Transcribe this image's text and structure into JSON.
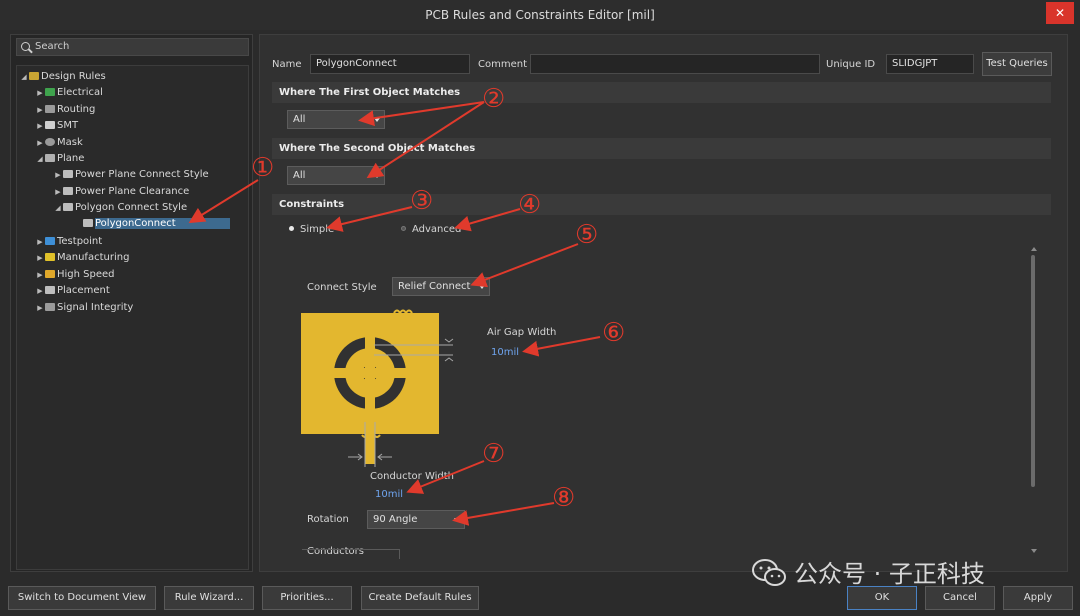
{
  "window": {
    "title": "PCB Rules and Constraints Editor [mil]",
    "close_glyph": "✕"
  },
  "search": {
    "placeholder": "Search"
  },
  "tree": {
    "root": "Design Rules",
    "items": [
      {
        "label": "Electrical",
        "icon": "electrical-icon",
        "color": "#3fa34d"
      },
      {
        "label": "Routing",
        "icon": "routing-icon",
        "color": "#9a9a9a"
      },
      {
        "label": "SMT",
        "icon": "smt-icon",
        "color": "#cfcfcf"
      },
      {
        "label": "Mask",
        "icon": "mask-icon",
        "color": "#9a9a9a"
      },
      {
        "label": "Plane",
        "icon": "plane-icon",
        "color": "#b0b0b0"
      },
      {
        "label": "Power Plane Connect Style",
        "icon": "rule-icon",
        "color": "#bdbdbd"
      },
      {
        "label": "Power Plane Clearance",
        "icon": "rule-icon",
        "color": "#bdbdbd"
      },
      {
        "label": "Polygon Connect Style",
        "icon": "rule-icon",
        "color": "#bdbdbd"
      },
      {
        "label": "PolygonConnect",
        "icon": "rule-icon",
        "color": "#bdbdbd"
      },
      {
        "label": "Testpoint",
        "icon": "testpoint-icon",
        "color": "#3e8fd6"
      },
      {
        "label": "Manufacturing",
        "icon": "manufacturing-icon",
        "color": "#e0c12a"
      },
      {
        "label": "High Speed",
        "icon": "high-speed-icon",
        "color": "#e0a82a"
      },
      {
        "label": "Placement",
        "icon": "placement-icon",
        "color": "#bdbdbd"
      },
      {
        "label": "Signal Integrity",
        "icon": "signal-integrity-icon",
        "color": "#9a9a9a"
      }
    ]
  },
  "rule": {
    "name_label": "Name",
    "name_value": "PolygonConnect",
    "comment_label": "Comment",
    "comment_value": "",
    "uid_label": "Unique ID",
    "uid_value": "SLIDGJPT",
    "test_queries": "Test Queries"
  },
  "sections": {
    "first": "Where The First Object Matches",
    "second": "Where The Second Object Matches",
    "constraints": "Constraints"
  },
  "first_match": "All",
  "second_match": "All",
  "mode": {
    "simple": "Simple",
    "advanced": "Advanced",
    "selected": "simple"
  },
  "connect_style": {
    "label": "Connect Style",
    "value": "Relief Connect"
  },
  "air_gap": {
    "label": "Air Gap Width",
    "value": "10mil"
  },
  "conductor_width": {
    "label": "Conductor Width",
    "value": "10mil"
  },
  "rotation": {
    "label": "Rotation",
    "value": "90 Angle"
  },
  "conductors": {
    "label": "Conductors"
  },
  "footer": {
    "switch": "Switch to Document View",
    "wizard": "Rule Wizard...",
    "priorities": "Priorities...",
    "defaults": "Create Default Rules",
    "ok": "OK",
    "cancel": "Cancel",
    "apply": "Apply"
  },
  "annotations": [
    "①",
    "②",
    "③",
    "④",
    "⑤",
    "⑥",
    "⑦",
    "⑧"
  ],
  "watermark": "公众号 · 子正科技",
  "colors": {
    "pad": "#e3b72f",
    "annotation": "#e03a2c",
    "link": "#6fa4ee",
    "selection": "#3d6a8f"
  }
}
